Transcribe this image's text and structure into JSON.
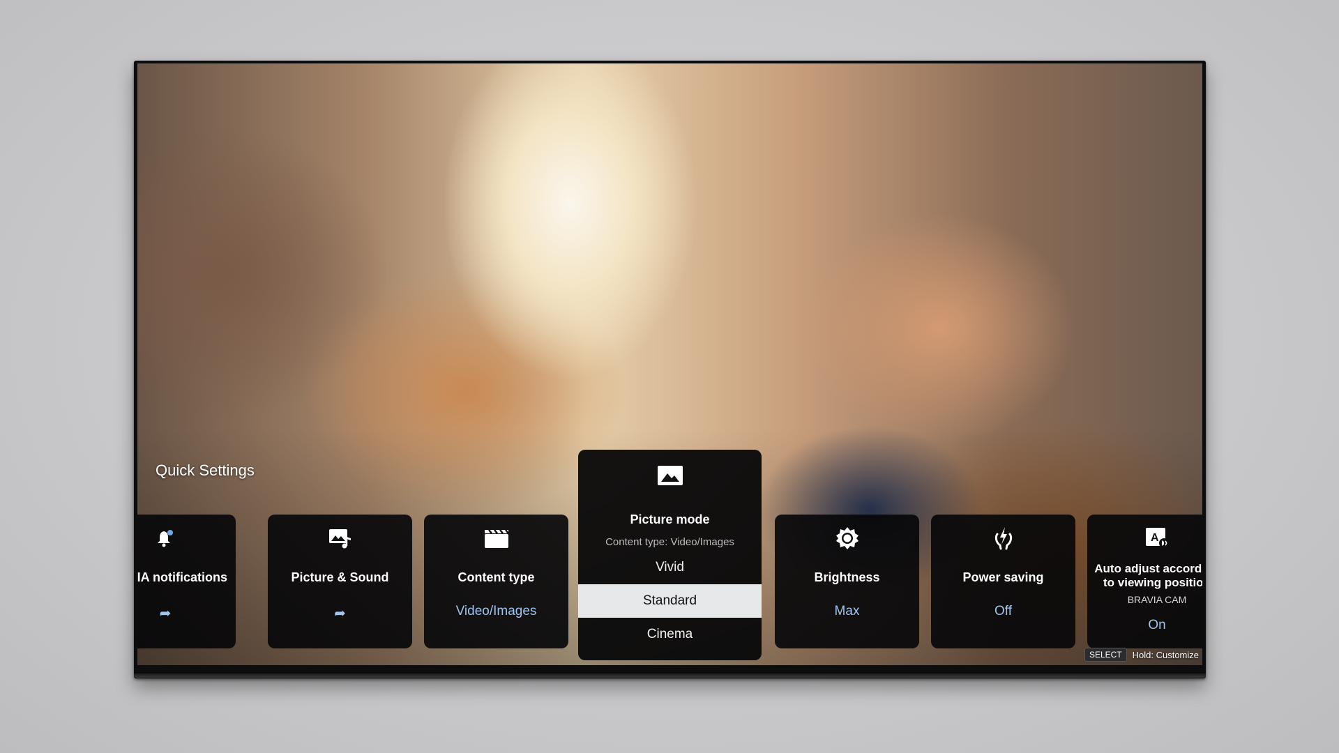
{
  "quick_settings": {
    "title": "Quick Settings",
    "cards": {
      "notifications": {
        "title": "BRAVIA notifications",
        "icon": "bell-icon"
      },
      "picture_sound": {
        "title": "Picture & Sound",
        "icon": "picture-sound-icon"
      },
      "content_type": {
        "title": "Content type",
        "value": "Video/Images",
        "icon": "clapperboard-icon"
      },
      "picture_mode": {
        "title": "Picture mode",
        "subtitle": "Content type: Video/Images",
        "icon": "image-icon",
        "options": [
          "Vivid",
          "Standard",
          "Cinema"
        ],
        "selected": "Standard"
      },
      "brightness": {
        "title": "Brightness",
        "value": "Max",
        "icon": "brightness-icon"
      },
      "power_saving": {
        "title": "Power saving",
        "value": "Off",
        "icon": "power-saving-icon"
      },
      "auto_adjust": {
        "title": "Auto adjust according to viewing position",
        "subtitle": "BRAVIA CAM",
        "value": "On",
        "icon": "auto-adjust-icon"
      }
    },
    "hint": {
      "key": "SELECT",
      "text": "Hold: Customize"
    }
  },
  "colors": {
    "accent_value": "#9fc4ee",
    "card_bg": "#08080a",
    "selected_bg": "#e7e8ea"
  }
}
